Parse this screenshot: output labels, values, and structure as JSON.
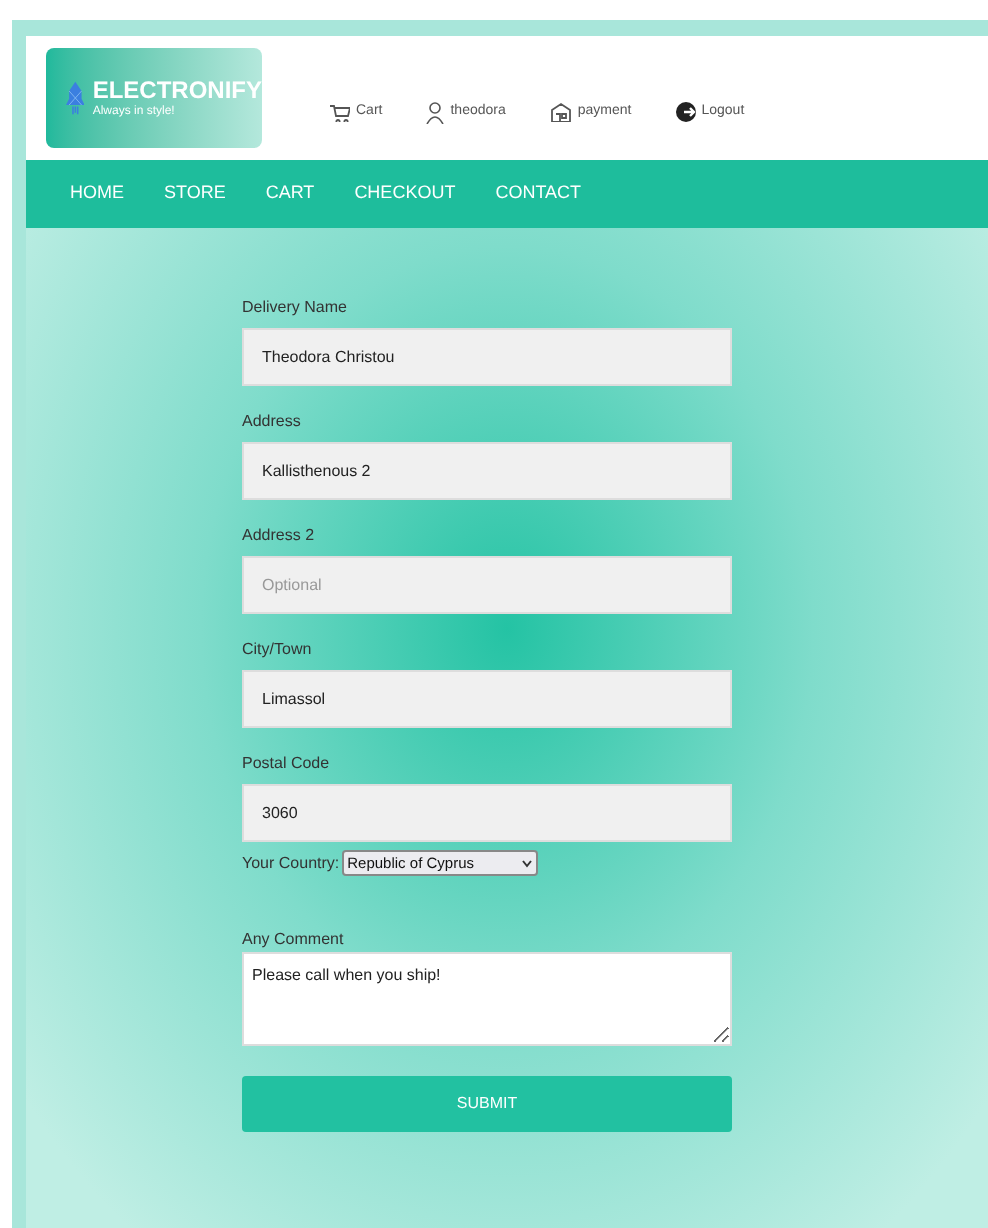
{
  "brand": {
    "name": "ELECTRONIFY",
    "tagline": "Always in style!"
  },
  "header_links": [
    {
      "kind": "cart",
      "label": "Cart"
    },
    {
      "kind": "user",
      "label": "theodora"
    },
    {
      "kind": "payment",
      "label": "payment"
    },
    {
      "kind": "logout",
      "label": "Logout"
    }
  ],
  "nav": [
    {
      "label": "HOME"
    },
    {
      "label": "STORE"
    },
    {
      "label": "CART"
    },
    {
      "label": "CHECKOUT"
    },
    {
      "label": "CONTACT"
    }
  ],
  "form": {
    "fields": [
      {
        "kind": "input",
        "label": "Delivery Name",
        "value": "Theodora Christou"
      },
      {
        "kind": "input",
        "label": "Address",
        "value": "Kallisthenous 2"
      },
      {
        "kind": "input",
        "label": "Address 2",
        "placeholder": "Optional"
      },
      {
        "kind": "input",
        "label": "City/Town",
        "value": "Limassol"
      },
      {
        "kind": "input",
        "label": "Postal Code",
        "value": "3060"
      },
      {
        "kind": "select",
        "label": "Your Country:",
        "value": "Republic of Cyprus"
      },
      {
        "kind": "textarea",
        "label": "Any Comment",
        "value": "Please call when you ship!"
      }
    ],
    "submit": "SUBMIT"
  }
}
